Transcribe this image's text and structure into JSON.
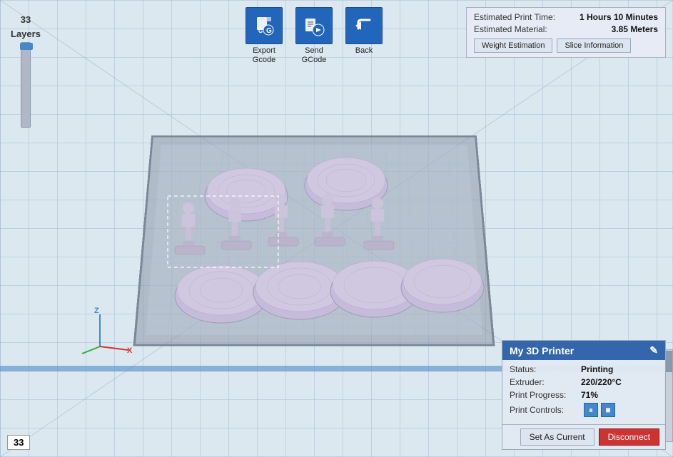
{
  "viewport": {
    "background": "#dce8f0"
  },
  "layers": {
    "total": "33",
    "label": "Layers",
    "current": "33"
  },
  "toolbar": {
    "export_gcode": {
      "label": "Export\nGcode",
      "icon": "📄"
    },
    "send_gcode": {
      "label": "Send\nGCode",
      "icon": "📤"
    },
    "back": {
      "label": "Back",
      "icon": "↩"
    }
  },
  "info_panel": {
    "estimated_print_time_label": "Estimated Print Time:",
    "estimated_print_time_value": "1 Hours 10 Minutes",
    "estimated_material_label": "Estimated Material:",
    "estimated_material_value": "3.85 Meters",
    "weight_estimation_btn": "Weight Estimation",
    "slice_information_btn": "Slice Information"
  },
  "printer_panel": {
    "title": "My 3D Printer",
    "status_label": "Status:",
    "status_value": "Printing",
    "extruder_label": "Extruder:",
    "extruder_value": "220/220°C",
    "progress_label": "Print Progress:",
    "progress_value": "71%",
    "controls_label": "Print Controls:",
    "pause_icon": "⏸",
    "stop_icon": "■",
    "set_as_current_btn": "Set As Current",
    "disconnect_btn": "Disconnect"
  }
}
